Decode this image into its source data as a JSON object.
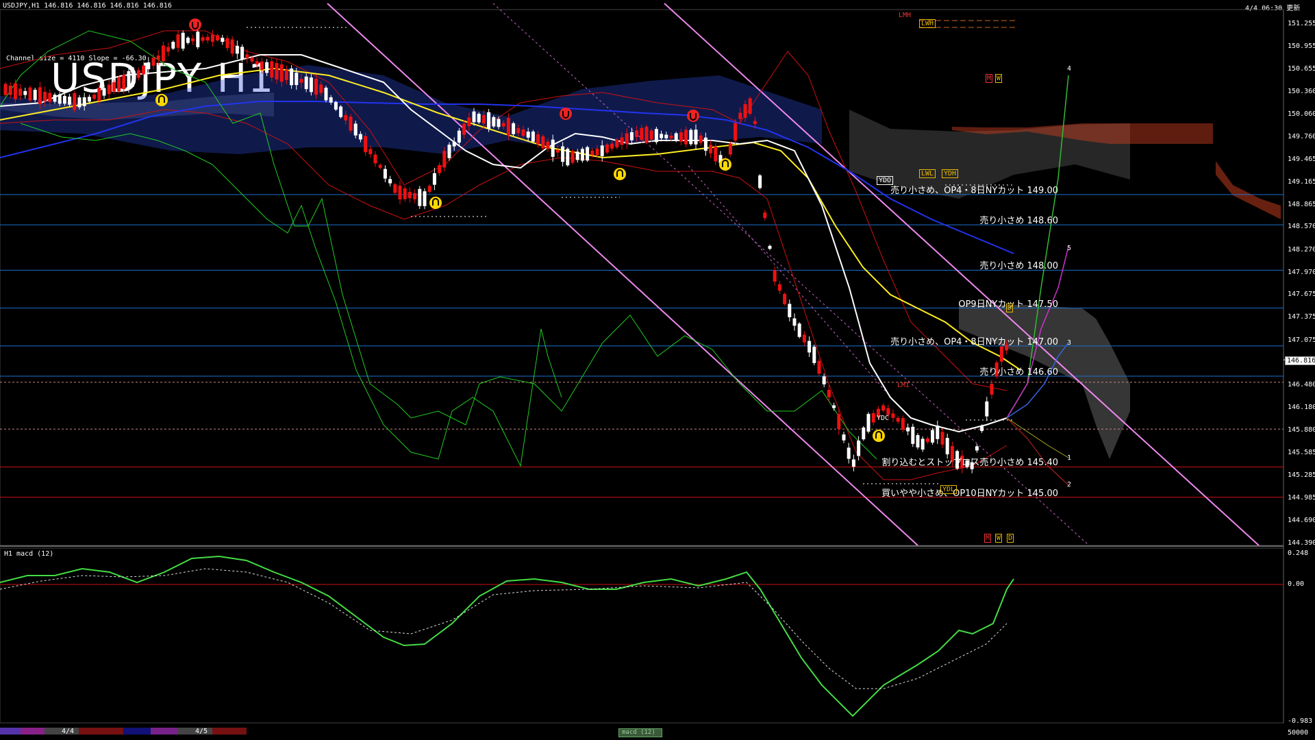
{
  "header": {
    "symbol_line": "USDJPY,H1  146.816  146.816  146.816  146.816",
    "timestamp": "4/4 06:30 更新",
    "channel_info": "Channel size = 4110 Slope = -66.30",
    "title_big": "USDJPY H1"
  },
  "price_axis": {
    "ticks": [
      "151.255",
      "150.955",
      "150.655",
      "150.360",
      "150.060",
      "149.760",
      "149.465",
      "149.165",
      "148.865",
      "148.570",
      "148.270",
      "147.970",
      "147.675",
      "147.375",
      "147.075",
      "146.775",
      "146.480",
      "146.180",
      "145.880",
      "145.585",
      "145.285",
      "144.985",
      "144.690",
      "144.390"
    ],
    "current_price": "146.816"
  },
  "levels": [
    {
      "label": "売り小さめ、OP4・8日NYカット 149.00",
      "color": "#1e6fd0"
    },
    {
      "label": "売り小さめ 148.60",
      "color": "#1e6fd0"
    },
    {
      "label": "売り小さめ 148.00",
      "color": "#1e6fd0"
    },
    {
      "label": "OP9日NYカット 147.50",
      "color": "#1e6fd0"
    },
    {
      "label": "売り小さめ、OP4・8日NYカット 147.00",
      "color": "#1e6fd0"
    },
    {
      "label": "売り小さめ 146.60",
      "color": "#1e6fd0"
    },
    {
      "label": "割り込むとストップロス売り小さめ 145.40",
      "color": "#cc1111"
    },
    {
      "label": "買いやや小さめ、OP10日NYカット 145.00",
      "color": "#cc1111"
    }
  ],
  "markers": {
    "lmh": "LMH",
    "lwh": "LWH",
    "m_top": "M",
    "w_top": "W",
    "ydo": "YDO",
    "lwl": "LWL",
    "ydh": "YDH",
    "d_mid": "D",
    "lmi": "LMI",
    "ydc": "YDC",
    "ydl": "YDL",
    "m_bot": "M",
    "w_bot": "W",
    "d_bot": "D"
  },
  "proj_labels": [
    "4",
    "5",
    "3",
    "1",
    "2"
  ],
  "macd": {
    "title": "H1  macd (12)",
    "ticks": [
      "0.248",
      "0.00",
      "-0.983",
      "50000"
    ]
  },
  "bottom_bar": {
    "date1": "4/4",
    "date2": "4/5",
    "macd_tab": "macd (12)"
  },
  "colors": {
    "bg": "#000000",
    "up": "#ffffff",
    "down": "#ee1111",
    "ma_fast": "#ffffff",
    "ma_mid": "#ffee22",
    "ma_slow": "#2233ee",
    "chikou": "#22cc22",
    "cloud_blue": "#2b4bd8",
    "cloud_red": "#d04020",
    "cloud_gray": "#9a9a9a",
    "band": "#cc1111",
    "channel": "#ee88ee",
    "level_blue": "#1e6fd0",
    "level_red": "#cc1111",
    "macd_up": "#44dd44",
    "macd_down": "#ee8899",
    "signal": "#dddddd"
  }
}
